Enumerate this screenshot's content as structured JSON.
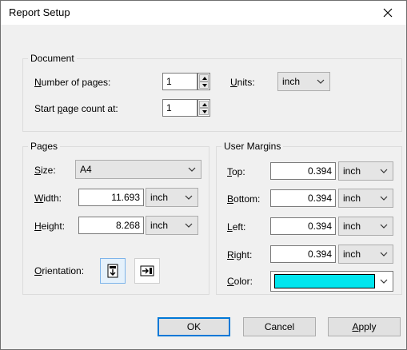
{
  "title": "Report Setup",
  "document": {
    "group_label": "Document",
    "num_pages_label_pre": "N",
    "num_pages_label_post": "umber of pages:",
    "num_pages_value": "1",
    "start_label_pre": "Start ",
    "start_label_ul": "p",
    "start_label_post": "age count at:",
    "start_value": "1",
    "units_label_ul": "U",
    "units_label_post": "nits:",
    "units_value": "inch"
  },
  "pages": {
    "group_label": "Pages",
    "size_label_ul": "S",
    "size_label_post": "ize:",
    "size_value": "A4",
    "width_label_ul": "W",
    "width_label_post": "idth:",
    "width_value": "11.693",
    "width_unit": "inch",
    "height_label_ul": "H",
    "height_label_post": "eight:",
    "height_value": "8.268",
    "height_unit": "inch",
    "orientation_label_ul": "O",
    "orientation_label_post": "rientation:"
  },
  "margins": {
    "group_label": "User Margins",
    "top_label_ul": "T",
    "top_label_post": "op:",
    "top_value": "0.394",
    "top_unit": "inch",
    "bottom_label_ul": "B",
    "bottom_label_post": "ottom:",
    "bottom_value": "0.394",
    "bottom_unit": "inch",
    "left_label_ul": "L",
    "left_label_post": "eft:",
    "left_value": "0.394",
    "left_unit": "inch",
    "right_label_ul": "R",
    "right_label_post": "ight:",
    "right_value": "0.394",
    "right_unit": "inch",
    "color_label_ul": "C",
    "color_label_post": "olor:",
    "color_value": "#00e5ee"
  },
  "buttons": {
    "ok": "OK",
    "cancel": "Cancel",
    "apply_ul": "A",
    "apply_post": "pply"
  },
  "icons": {
    "close": "close-icon",
    "spin_up": "spin-up-icon",
    "spin_down": "spin-down-icon",
    "chevron": "chevron-down-icon",
    "portrait": "portrait-orientation-icon",
    "landscape": "landscape-orientation-icon"
  }
}
